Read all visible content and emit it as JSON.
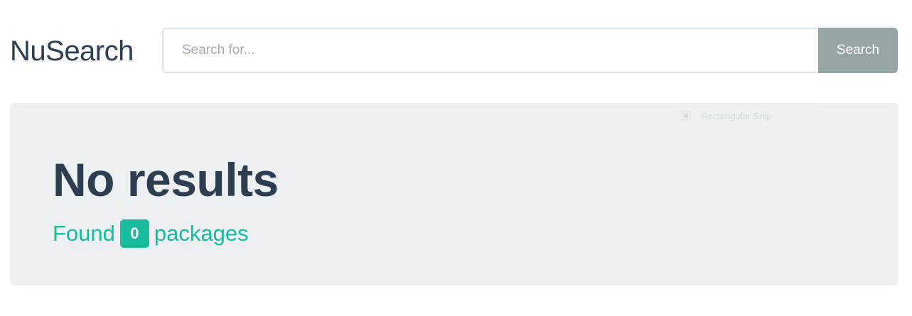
{
  "header": {
    "brand": "NuSearch",
    "search": {
      "placeholder": "Search for...",
      "value": "",
      "button_label": "Search"
    }
  },
  "overlay": {
    "icon": "snip-icon",
    "label": "Rectangular Snip"
  },
  "results": {
    "title": "No results",
    "count_prefix": "Found",
    "count": "0",
    "count_suffix": "packages"
  },
  "colors": {
    "text": "#2c3e50",
    "accent": "#18bc9c",
    "panel": "#ecf0f1",
    "button": "#95a5a6"
  }
}
